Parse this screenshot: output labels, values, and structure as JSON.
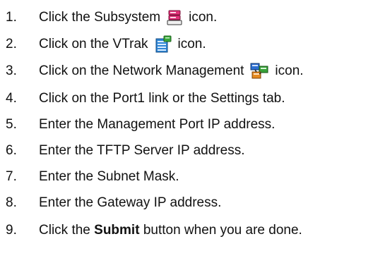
{
  "steps": [
    {
      "number": "1.",
      "before": "Click the Subsystem",
      "icon": "subsystem-icon",
      "after": "icon."
    },
    {
      "number": "2.",
      "before": "Click on the VTrak",
      "icon": "vtrak-icon",
      "after": "icon."
    },
    {
      "number": "3.",
      "before": "Click on the Network Management",
      "icon": "network-management-icon",
      "after": "icon."
    },
    {
      "number": "4.",
      "text": "Click on the Port1 link or the Settings tab."
    },
    {
      "number": "5.",
      "text": "Enter the Management Port IP address."
    },
    {
      "number": "6.",
      "text": "Enter the TFTP Server IP address."
    },
    {
      "number": "7.",
      "text": "Enter the Subnet Mask."
    },
    {
      "number": "8.",
      "text": "Enter the Gateway IP address."
    },
    {
      "number": "9.",
      "before": "Click the",
      "bold": "Submit",
      "after": "button when you are done."
    }
  ],
  "colors": {
    "subsystem": "#e0307a",
    "vtrak": "#2f86d6",
    "vtrak_accent": "#3aa83a",
    "net_blue": "#2d6fd1",
    "net_green": "#38a23a",
    "net_orange": "#e58a1f"
  }
}
